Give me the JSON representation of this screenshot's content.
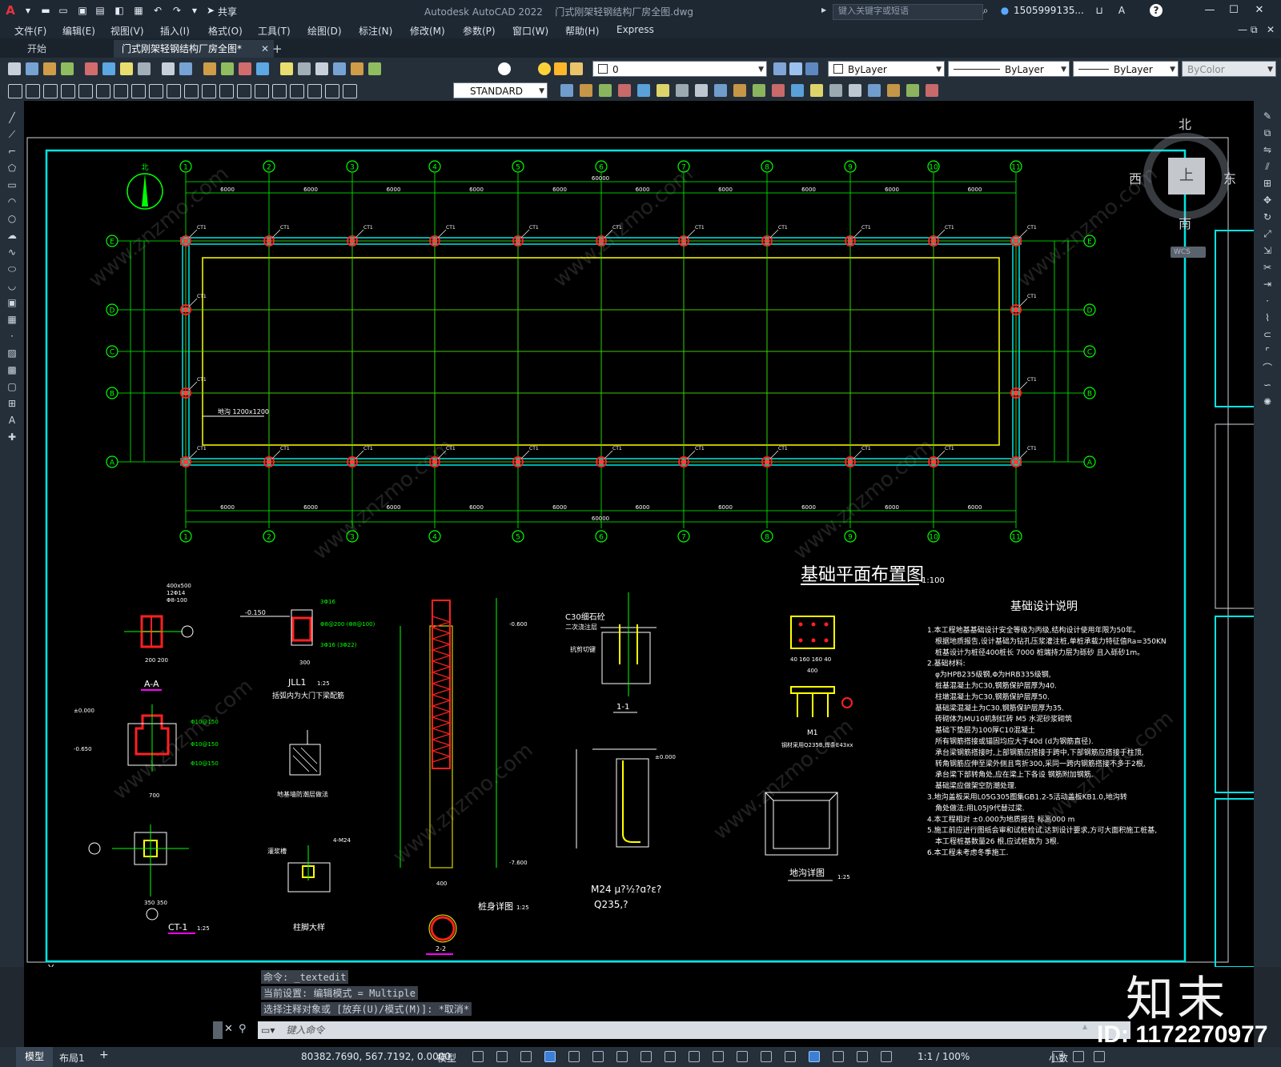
{
  "app": {
    "name": "Autodesk AutoCAD 2022",
    "file_name": "门式刚架轻钢结构厂房全图.dwg",
    "share_label": "共享",
    "search_placeholder": "键入关键字或短语",
    "user": "1505999135...",
    "help_icon": "?"
  },
  "menu": [
    "文件(F)",
    "编辑(E)",
    "视图(V)",
    "插入(I)",
    "格式(O)",
    "工具(T)",
    "绘图(D)",
    "标注(N)",
    "修改(M)",
    "参数(P)",
    "窗口(W)",
    "帮助(H)",
    "Express"
  ],
  "tabs": {
    "start": "开始",
    "active": "门式刚架轻钢结构厂房全图*",
    "add": "+"
  },
  "toolbar": {
    "layer": "0",
    "color": "ByLayer",
    "linetype": "ByLayer",
    "lineweight": "ByLayer",
    "plotstyle": "ByColor",
    "textstyle": "STANDARD"
  },
  "viewcube": {
    "north": "北",
    "south": "南",
    "east": "东",
    "west": "西",
    "top": "上",
    "wcs": "WCS"
  },
  "drawing": {
    "main_title": "基础平面布置图",
    "main_scale": "1:100",
    "notes_title": "基础设计说明",
    "notes": [
      "1.本工程地基基础设计安全等级为丙级,结构设计使用年限为50年。",
      "根据地质报告,设计基础为钻孔压浆灌注桩,单桩承载力特征值Ra=350KN",
      "桩基设计为桩径400桩长 7000 桩端持力层为砾砂 且入砾砂1m。",
      "2.基础材料:",
      "φ为HPB235级钢,Φ为HRB335级钢,",
      "桩基混凝土为C30,钢筋保护层厚为40.",
      "柱墩混凝土为C30,钢筋保护层厚50.",
      "基础梁混凝土为C30,钢筋保护层厚为35.",
      "砖砌体为MU10机制红砖 M5 水泥砂浆砌筑",
      "基础下垫层为100厚C10混凝土",
      "所有钢筋搭接或锚固均应大于40d (d为钢筋直径).",
      "承台梁钢筋搭接时,上部钢筋应搭接于跨中,下部钢筋应搭接于柱顶,",
      "转角钢筋应伸至梁外侧且弯折300,采同一跨内钢筋搭接不多于2根,",
      "承台梁下部转角处,应在梁上下各设 钢筋附加钢筋.",
      "基础梁应做架空防潮处理.",
      "3.地沟盖板采用L05G305图集GB1.2-5活动盖板KB1.0,地沟转",
      "角处做法:用L05J9代替过梁.",
      "4.本工程相对 ±0.000为地质报告 标高000 m",
      "5.施工前应进行图纸会审和试桩检试,达到设计要求,方可大面积施工桩基,",
      "本工程桩基数量26 根,应试桩数为 3根.",
      "6.本工程未考虑冬季施工."
    ],
    "details": {
      "aa": "A-A",
      "jll1": "JLL1",
      "jll1_scale": "1:25",
      "jll1_note": "括弧内为大门下梁配筋",
      "dqpw": "地基墙防潮层做法",
      "zjdy": "柱脚大样",
      "ct1": "CT-1",
      "ct1_scale": "1:25",
      "zsxt": "桩身详图",
      "zsxt_scale": "1:25",
      "s22": "2-2",
      "s11": "1-1",
      "m1": "M1",
      "m1_note": "钢材采用Q235B,焊条E43xx",
      "dgxt": "地沟详图",
      "dgxt_scale": "1:25",
      "m24": "M24 μ?½?ɑ?ε?",
      "q235": "Q235,?",
      "c30_label": "C30细石砼二次浇注层",
      "diagou": "地沟 1200x1200"
    },
    "axes_top": [
      "1",
      "2",
      "3",
      "4",
      "5",
      "6",
      "7",
      "8",
      "9",
      "10",
      "11"
    ],
    "axes_left": [
      "E",
      "D",
      "C",
      "B",
      "A"
    ],
    "bay_dims": [
      "6000",
      "6000",
      "6000",
      "6000",
      "6000",
      "6000",
      "6000",
      "6000",
      "6000",
      "6000"
    ],
    "total_dim": "60000",
    "north_label": "北"
  },
  "command": {
    "line1": "命令: _textedit",
    "line2": "当前设置: 编辑模式 = Multiple",
    "line3": "选择注释对象或 [放弃(U)/模式(M)]: *取消*",
    "prompt": "键入命令"
  },
  "status": {
    "model_tab": "模型",
    "layout_tab": "布局1",
    "coords": "80382.7690, 567.7192, 0.0000",
    "space": "模型",
    "scale": "1:1 / 100%",
    "units": "小数"
  },
  "watermark": {
    "logo": "知末",
    "id": "ID: 1172270977",
    "site": "www.znzmo.com"
  },
  "colors": {
    "axis": "#00ff00",
    "grid_red": "#ff0000",
    "frame": "#00e5e5",
    "yellow": "#ffff00",
    "accent": "#1f8fff"
  }
}
